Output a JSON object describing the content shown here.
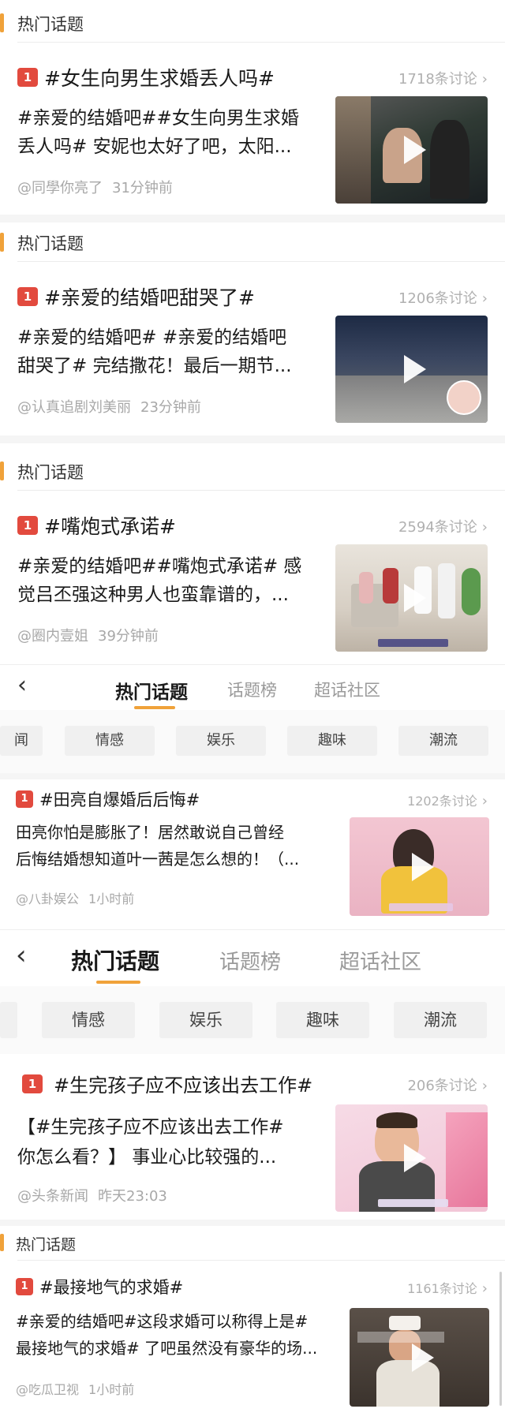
{
  "section_title": "热门话题",
  "nav1": {
    "tabs": [
      "热门话题",
      "话题榜",
      "超话社区"
    ],
    "chips": [
      "闻",
      "情感",
      "娱乐",
      "趣味",
      "潮流"
    ]
  },
  "nav2": {
    "tabs": [
      "热门话题",
      "话题榜",
      "超话社区"
    ],
    "chips": [
      "情感",
      "娱乐",
      "趣味",
      "潮流"
    ]
  },
  "cards": [
    {
      "rank": "1",
      "topic": "#女生向男生求婚丢人吗#",
      "count": "1718条讨论",
      "line1": "#亲爱的结婚吧##女生向男生求婚",
      "line2": "丢人吗# 安妮也太好了吧，太阳...",
      "author": "@同學你亮了",
      "time": "31分钟前"
    },
    {
      "rank": "1",
      "topic": "#亲爱的结婚吧甜哭了#",
      "count": "1206条讨论",
      "line1": "#亲爱的结婚吧# #亲爱的结婚吧",
      "line2": "甜哭了# 完结撒花！最后一期节...",
      "author": "@认真追剧刘美丽",
      "time": "23分钟前"
    },
    {
      "rank": "1",
      "topic": "#嘴炮式承诺#",
      "count": "2594条讨论",
      "line1": "#亲爱的结婚吧##嘴炮式承诺# 感",
      "line2": "觉吕丕强这种男人也蛮靠谱的，...",
      "author": "@圈内壹姐",
      "time": "39分钟前"
    },
    {
      "rank": "1",
      "topic": "#田亮自爆婚后后悔#",
      "count": "1202条讨论",
      "line1": "田亮你怕是膨胀了！居然敢说自己曾经",
      "line2": "后悔结婚想知道叶一茜是怎么想的！（...",
      "author": "@八卦娱公",
      "time": "1小时前"
    },
    {
      "rank": "1",
      "topic": "#生完孩子应不应该出去工作#",
      "count": "206条讨论",
      "line1": "【#生完孩子应不应该出去工作#",
      "line2": "你怎么看？】 事业心比较强的...",
      "author": "@头条新闻",
      "time": "昨天23:03"
    },
    {
      "rank": "1",
      "topic": "#最接地气的求婚#",
      "count": "1161条讨论",
      "line1": "#亲爱的结婚吧#这段求婚可以称得上是#",
      "line2": "最接地气的求婚# 了吧虽然没有豪华的场...",
      "author": "@吃瓜卫视",
      "time": "1小时前"
    }
  ],
  "chevron": "›",
  "back_glyph": "‹"
}
